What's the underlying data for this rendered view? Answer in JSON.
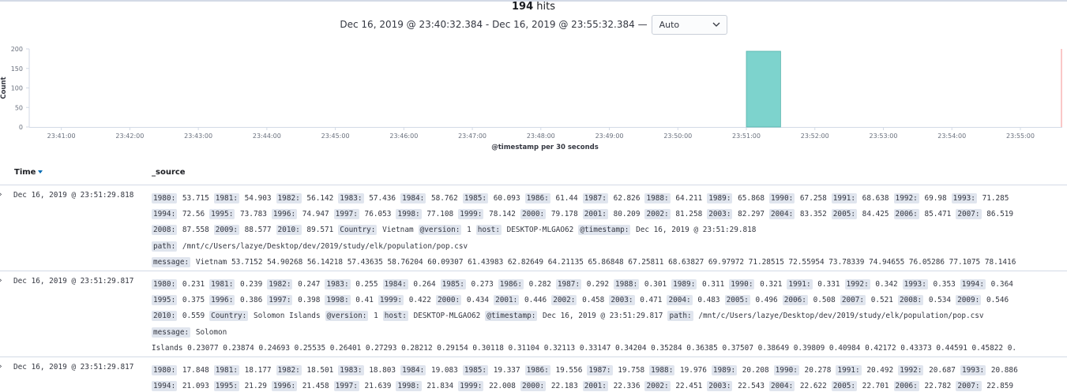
{
  "header": {
    "hits_count": "194",
    "hits_label": "hits",
    "time_range": "Dec 16, 2019 @ 23:40:32.384 - Dec 16, 2019 @ 23:55:32.384 —",
    "interval": "Auto"
  },
  "chart_data": {
    "type": "bar",
    "ylabel": "Count",
    "xlabel": "@timestamp per 30 seconds",
    "ylim": [
      0,
      200
    ],
    "yticks": [
      0,
      50,
      100,
      150,
      200
    ],
    "xticks": [
      "23:41:00",
      "23:42:00",
      "23:43:00",
      "23:44:00",
      "23:45:00",
      "23:46:00",
      "23:47:00",
      "23:48:00",
      "23:49:00",
      "23:50:00",
      "23:51:00",
      "23:52:00",
      "23:53:00",
      "23:54:00",
      "23:55:00"
    ],
    "x_range": [
      "23:40:32.384",
      "23:55:32.384"
    ],
    "bars": [
      {
        "x": "23:51:00",
        "width_seconds": 30,
        "value": 194
      }
    ],
    "colors": {
      "bar": "#7dd3cd",
      "bar_edge": "#54b3ac",
      "range_end": "#f58f8f"
    }
  },
  "table": {
    "time_header": "Time",
    "source_header": "_source",
    "rows": [
      {
        "time": "Dec 16, 2019 @ 23:51:29.818",
        "lines": [
          [
            [
              "1980:",
              "53.715"
            ],
            [
              "1981:",
              "54.903"
            ],
            [
              "1982:",
              "56.142"
            ],
            [
              "1983:",
              "57.436"
            ],
            [
              "1984:",
              "58.762"
            ],
            [
              "1985:",
              "60.093"
            ],
            [
              "1986:",
              "61.44"
            ],
            [
              "1987:",
              "62.826"
            ],
            [
              "1988:",
              "64.211"
            ],
            [
              "1989:",
              "65.868"
            ],
            [
              "1990:",
              "67.258"
            ],
            [
              "1991:",
              "68.638"
            ],
            [
              "1992:",
              "69.98"
            ],
            [
              "1993:",
              "71.285"
            ]
          ],
          [
            [
              "1994:",
              "72.56"
            ],
            [
              "1995:",
              "73.783"
            ],
            [
              "1996:",
              "74.947"
            ],
            [
              "1997:",
              "76.053"
            ],
            [
              "1998:",
              "77.108"
            ],
            [
              "1999:",
              "78.142"
            ],
            [
              "2000:",
              "79.178"
            ],
            [
              "2001:",
              "80.209"
            ],
            [
              "2002:",
              "81.258"
            ],
            [
              "2003:",
              "82.297"
            ],
            [
              "2004:",
              "83.352"
            ],
            [
              "2005:",
              "84.425"
            ],
            [
              "2006:",
              "85.471"
            ],
            [
              "2007:",
              "86.519"
            ]
          ],
          [
            [
              "2008:",
              "87.558"
            ],
            [
              "2009:",
              "88.577"
            ],
            [
              "2010:",
              "89.571"
            ],
            [
              "Country:",
              "Vietnam"
            ],
            [
              "@version:",
              "1"
            ],
            [
              "host:",
              "DESKTOP-MLGAO62"
            ],
            [
              "@timestamp:",
              "Dec 16, 2019 @ 23:51:29.818"
            ]
          ],
          [
            [
              "path:",
              "/mnt/c/Users/lazye/Desktop/dev/2019/study/elk/population/pop.csv"
            ]
          ],
          [
            [
              "message:",
              "Vietnam 53.7152 54.90268 56.14218 57.43635 58.76204 60.09307 61.43983 62.82649 64.21135 65.86848 67.25811 68.63827 69.97972 71.28515 72.55954 73.78339 74.94655 76.05286 77.1075 78.1416"
            ]
          ]
        ]
      },
      {
        "time": "Dec 16, 2019 @ 23:51:29.817",
        "lines": [
          [
            [
              "1980:",
              "0.231"
            ],
            [
              "1981:",
              "0.239"
            ],
            [
              "1982:",
              "0.247"
            ],
            [
              "1983:",
              "0.255"
            ],
            [
              "1984:",
              "0.264"
            ],
            [
              "1985:",
              "0.273"
            ],
            [
              "1986:",
              "0.282"
            ],
            [
              "1987:",
              "0.292"
            ],
            [
              "1988:",
              "0.301"
            ],
            [
              "1989:",
              "0.311"
            ],
            [
              "1990:",
              "0.321"
            ],
            [
              "1991:",
              "0.331"
            ],
            [
              "1992:",
              "0.342"
            ],
            [
              "1993:",
              "0.353"
            ],
            [
              "1994:",
              "0.364"
            ]
          ],
          [
            [
              "1995:",
              "0.375"
            ],
            [
              "1996:",
              "0.386"
            ],
            [
              "1997:",
              "0.398"
            ],
            [
              "1998:",
              "0.41"
            ],
            [
              "1999:",
              "0.422"
            ],
            [
              "2000:",
              "0.434"
            ],
            [
              "2001:",
              "0.446"
            ],
            [
              "2002:",
              "0.458"
            ],
            [
              "2003:",
              "0.471"
            ],
            [
              "2004:",
              "0.483"
            ],
            [
              "2005:",
              "0.496"
            ],
            [
              "2006:",
              "0.508"
            ],
            [
              "2007:",
              "0.521"
            ],
            [
              "2008:",
              "0.534"
            ],
            [
              "2009:",
              "0.546"
            ]
          ],
          [
            [
              "2010:",
              "0.559"
            ],
            [
              "Country:",
              "Solomon Islands"
            ],
            [
              "@version:",
              "1"
            ],
            [
              "host:",
              "DESKTOP-MLGAO62"
            ],
            [
              "@timestamp:",
              "Dec 16, 2019 @ 23:51:29.817"
            ],
            [
              "path:",
              "/mnt/c/Users/lazye/Desktop/dev/2019/study/elk/population/pop.csv"
            ]
          ],
          [
            [
              "message:",
              "Solomon"
            ]
          ],
          [
            [
              "",
              "Islands 0.23077 0.23874 0.24693 0.25535 0.26401 0.27293 0.28212 0.29154 0.30118 0.31104 0.32113 0.33147 0.34204 0.35284 0.36385 0.37507 0.38649 0.39809 0.40984 0.42172 0.43373 0.44591 0.45822 0."
            ]
          ]
        ]
      },
      {
        "time": "Dec 16, 2019 @ 23:51:29.817",
        "lines": [
          [
            [
              "1980:",
              "17.848"
            ],
            [
              "1981:",
              "18.177"
            ],
            [
              "1982:",
              "18.501"
            ],
            [
              "1983:",
              "18.803"
            ],
            [
              "1984:",
              "19.083"
            ],
            [
              "1985:",
              "19.337"
            ],
            [
              "1986:",
              "19.556"
            ],
            [
              "1987:",
              "19.758"
            ],
            [
              "1988:",
              "19.976"
            ],
            [
              "1989:",
              "20.208"
            ],
            [
              "1990:",
              "20.278"
            ],
            [
              "1991:",
              "20.492"
            ],
            [
              "1992:",
              "20.687"
            ],
            [
              "1993:",
              "20.886"
            ]
          ],
          [
            [
              "1994:",
              "21.093"
            ],
            [
              "1995:",
              "21.29"
            ],
            [
              "1996:",
              "21.458"
            ],
            [
              "1997:",
              "21.639"
            ],
            [
              "1998:",
              "21.834"
            ],
            [
              "1999:",
              "22.008"
            ],
            [
              "2000:",
              "22.183"
            ],
            [
              "2001:",
              "22.336"
            ],
            [
              "2002:",
              "22.451"
            ],
            [
              "2003:",
              "22.543"
            ],
            [
              "2004:",
              "22.622"
            ],
            [
              "2005:",
              "22.701"
            ],
            [
              "2006:",
              "22.782"
            ],
            [
              "2007:",
              "22.859"
            ]
          ]
        ]
      }
    ]
  }
}
